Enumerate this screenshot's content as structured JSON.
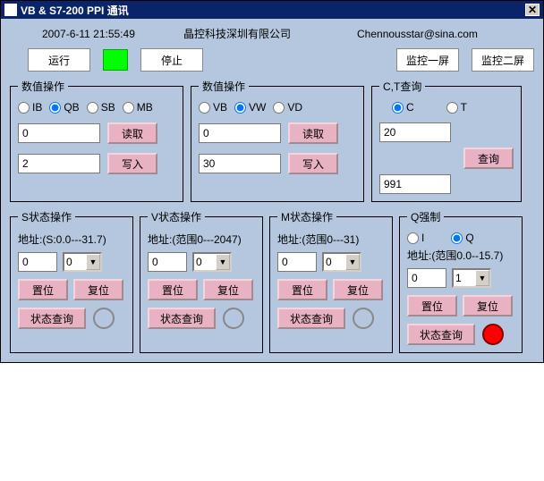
{
  "titlebar": {
    "text": "VB & S7-200 PPI 通讯"
  },
  "info": {
    "timestamp": "2007-6-11 21:55:49",
    "company": "晶控科技深圳有限公司",
    "email": "Chennousstar@sina.com"
  },
  "toprow": {
    "run": "运行",
    "stop": "停止",
    "mon1": "监控一屏",
    "mon2": "监控二屏"
  },
  "g1": {
    "legend": "数值操作",
    "r": {
      "ib": "IB",
      "qb": "QB",
      "sb": "SB",
      "mb": "MB"
    },
    "read_val": "0",
    "read_btn": "读取",
    "write_val": "2",
    "write_btn": "写入"
  },
  "g2": {
    "legend": "数值操作",
    "r": {
      "vb": "VB",
      "vw": "VW",
      "vd": "VD"
    },
    "read_val": "0",
    "read_btn": "读取",
    "write_val": "30",
    "write_btn": "写入"
  },
  "g3": {
    "legend": "C,T查询",
    "r": {
      "c": "C",
      "t": "T"
    },
    "v1": "20",
    "v2": "991",
    "btn": "查询"
  },
  "s": {
    "legend": "S状态操作",
    "addr": "地址:(S:0.0---31.7)",
    "addr_val": "0",
    "cnt": "0",
    "set": "置位",
    "reset": "复位",
    "query": "状态查询"
  },
  "v": {
    "legend": "V状态操作",
    "addr": "地址:(范围0---2047)",
    "addr_val": "0",
    "cnt": "0",
    "set": "置位",
    "reset": "复位",
    "query": "状态查询"
  },
  "m": {
    "legend": "M状态操作",
    "addr": "地址:(范围0---31)",
    "addr_val": "0",
    "cnt": "0",
    "set": "置位",
    "reset": "复位",
    "query": "状态查询"
  },
  "q": {
    "legend": "Q强制",
    "ri": "I",
    "rq": "Q",
    "addr": "地址:(范围0.0--15.7)",
    "addr_val": "0",
    "cnt": "1",
    "set": "置位",
    "reset": "复位",
    "query": "状态查询"
  }
}
